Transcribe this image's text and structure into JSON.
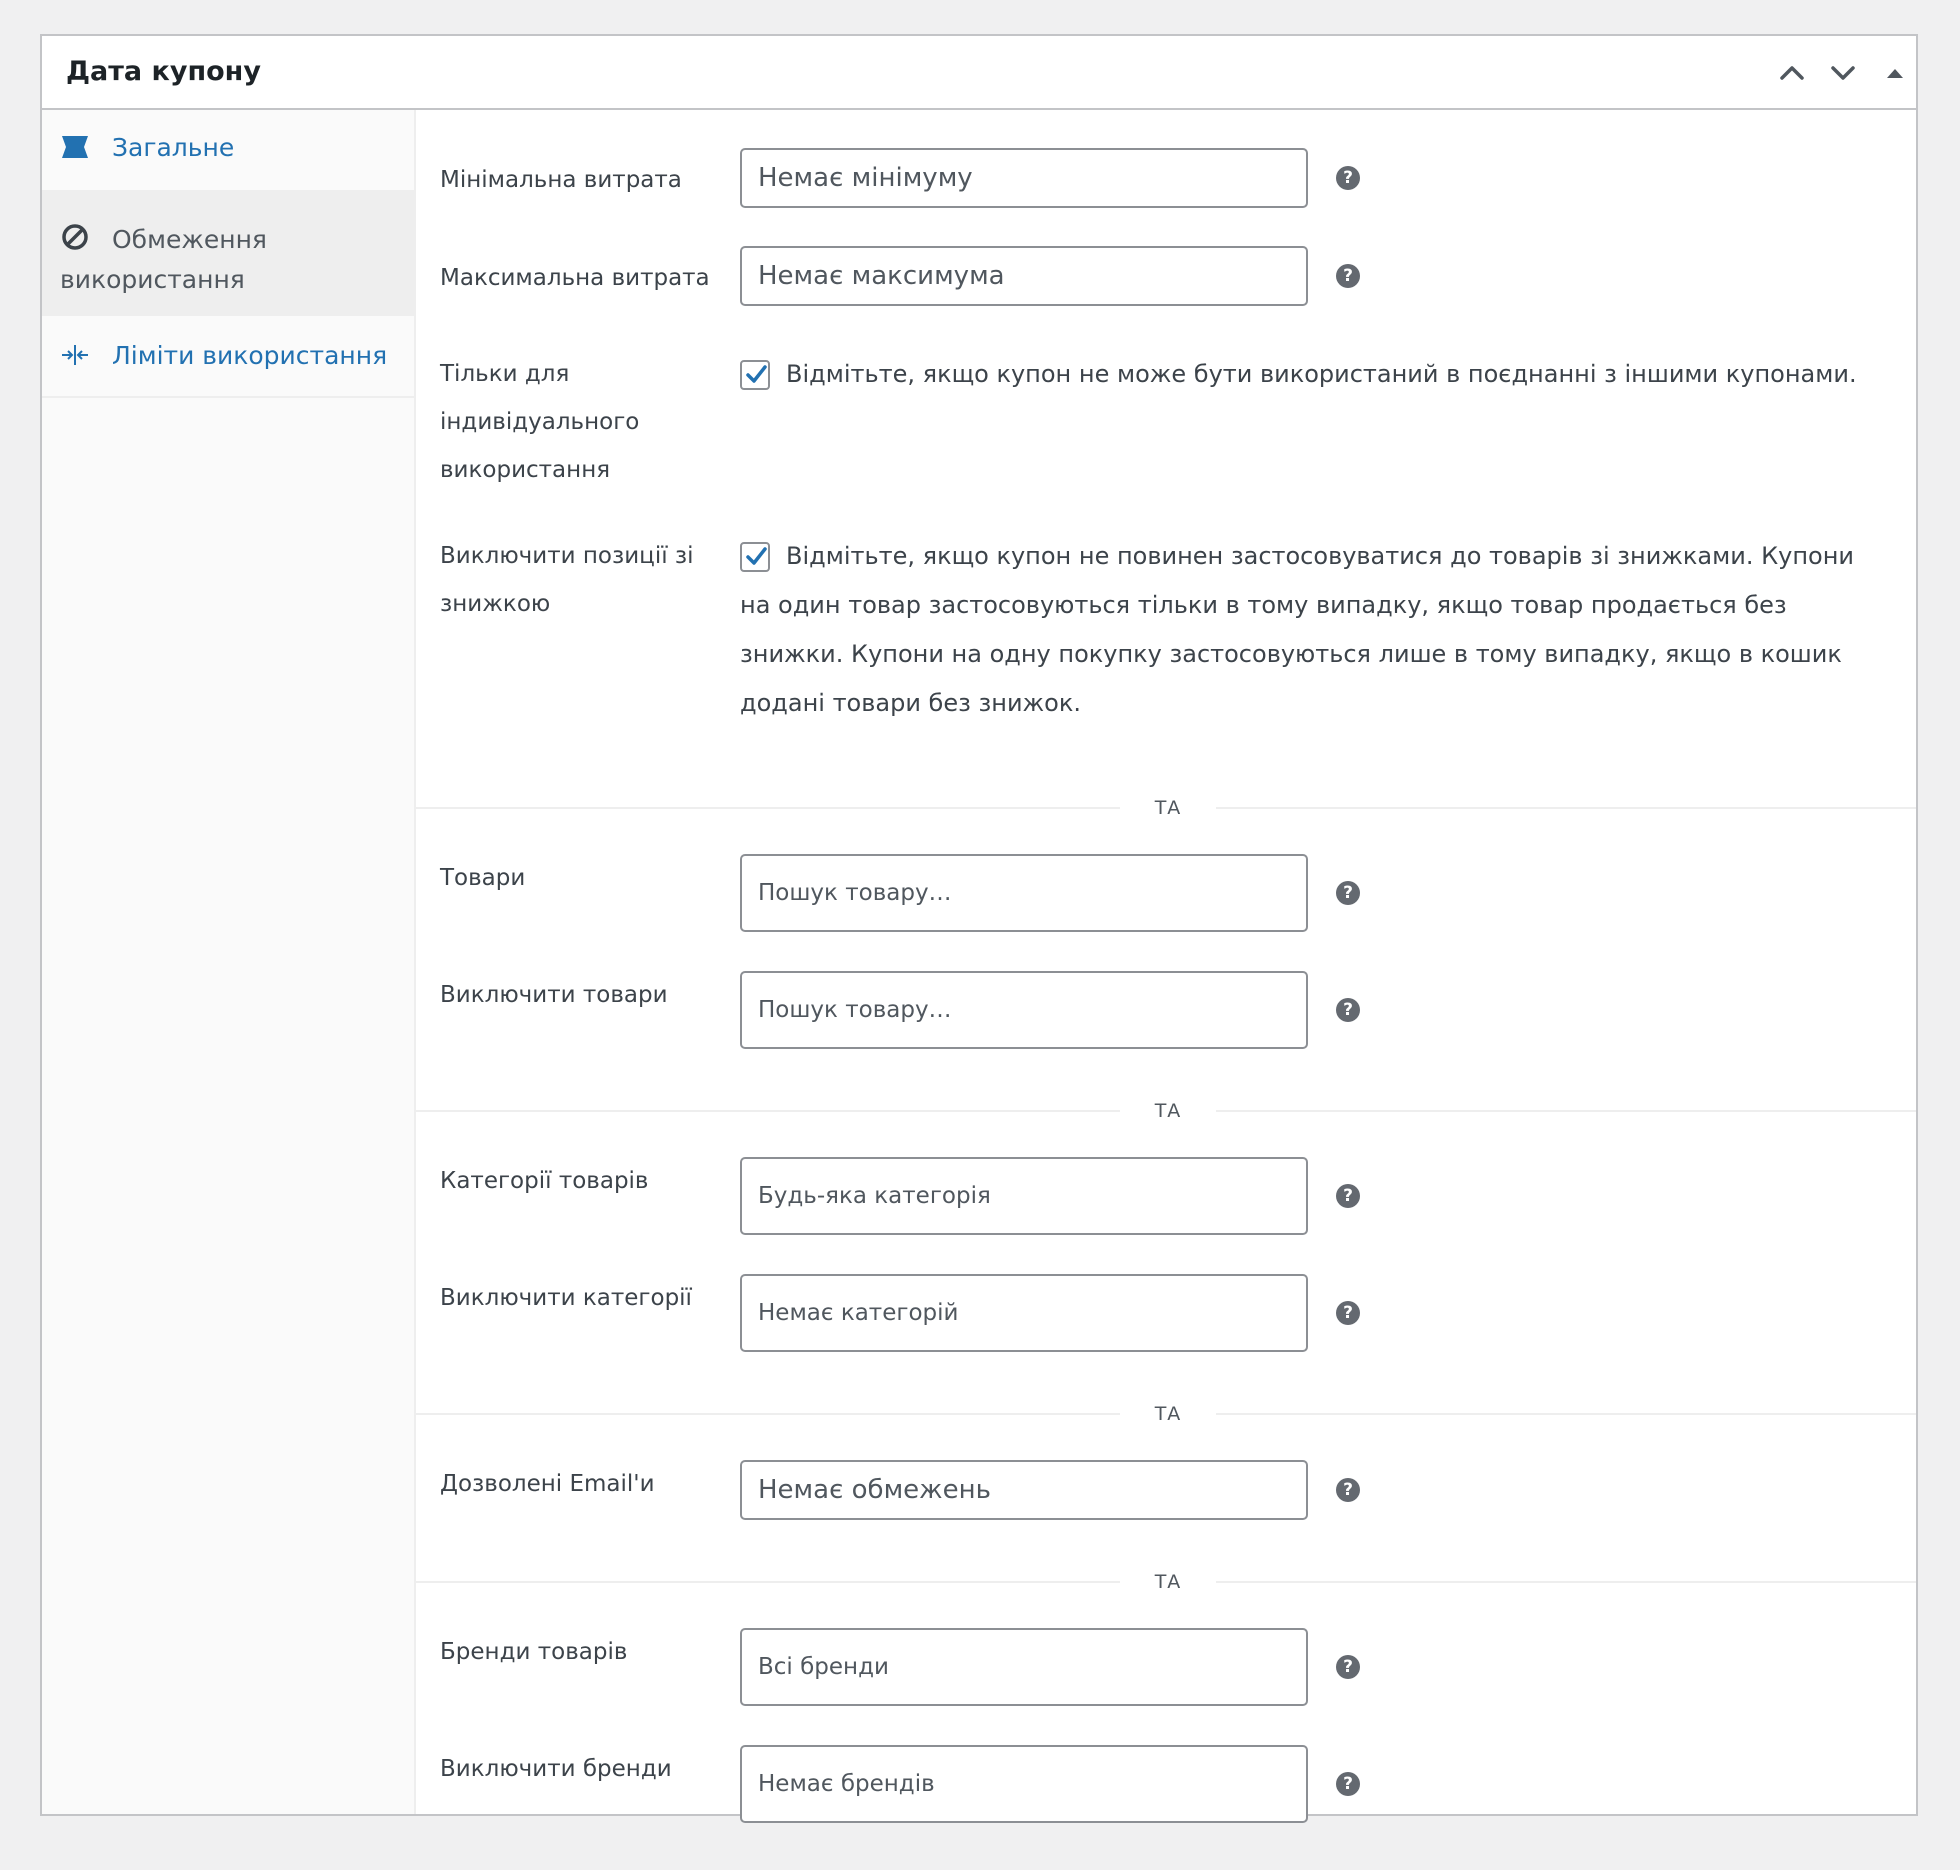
{
  "window": {
    "title": "Дата купону",
    "move_up_icon": "chevron-up-icon",
    "move_down_icon": "chevron-down-icon",
    "toggle_icon": "triangle-up-icon"
  },
  "tabs": [
    {
      "label": "Загальне",
      "icon": "ticket-icon",
      "active": false
    },
    {
      "label": "Обмеження використання",
      "icon": "no-entry-icon",
      "active": true
    },
    {
      "label": "Ліміти використання",
      "icon": "arrows-in-icon",
      "active": false
    }
  ],
  "colors": {
    "link": "#2271b1",
    "check": "#2271b1",
    "active_tab_bg": "#eeeeee"
  },
  "fields": {
    "min_spend": {
      "label": "Мінімальна витрата",
      "placeholder": "Немає мінімуму"
    },
    "max_spend": {
      "label": "Максимальна витрата",
      "placeholder": "Немає максимума"
    },
    "individual_use": {
      "label": "Тільки для індивідуального використання",
      "checked": true,
      "description": "Відмітьте, якщо купон не може бути використаний в поєднанні з іншими купонами."
    },
    "exclude_sale": {
      "label": "Виключити позиції зі знижкою",
      "checked": true,
      "description": "Відмітьте, якщо купон не повинен застосовуватися до товарів зі знижками. Купони на один товар застосовуються тільки в тому випадку, якщо товар продається без знижки. Купони на одну покупку застосовуються лише в тому випадку, якщо в кошик додані товари без знижок."
    },
    "products": {
      "label": "Товари",
      "placeholder": "Пошук товару…"
    },
    "exclude_products": {
      "label": "Виключити товари",
      "placeholder": "Пошук товару…"
    },
    "categories": {
      "label": "Категорії товарів",
      "placeholder": "Будь-яка категорія"
    },
    "exclude_categories": {
      "label": "Виключити категорії",
      "placeholder": "Немає категорій"
    },
    "emails": {
      "label": "Дозволені Email'и",
      "placeholder": "Немає обмежень"
    },
    "brands": {
      "label": "Бренди товарів",
      "placeholder": "Всі бренди"
    },
    "exclude_brands": {
      "label": "Виключити бренди",
      "placeholder": "Немає брендів"
    }
  },
  "separators": [
    "ТА",
    "ТА",
    "ТА",
    "ТА"
  ],
  "help_glyph": "?"
}
